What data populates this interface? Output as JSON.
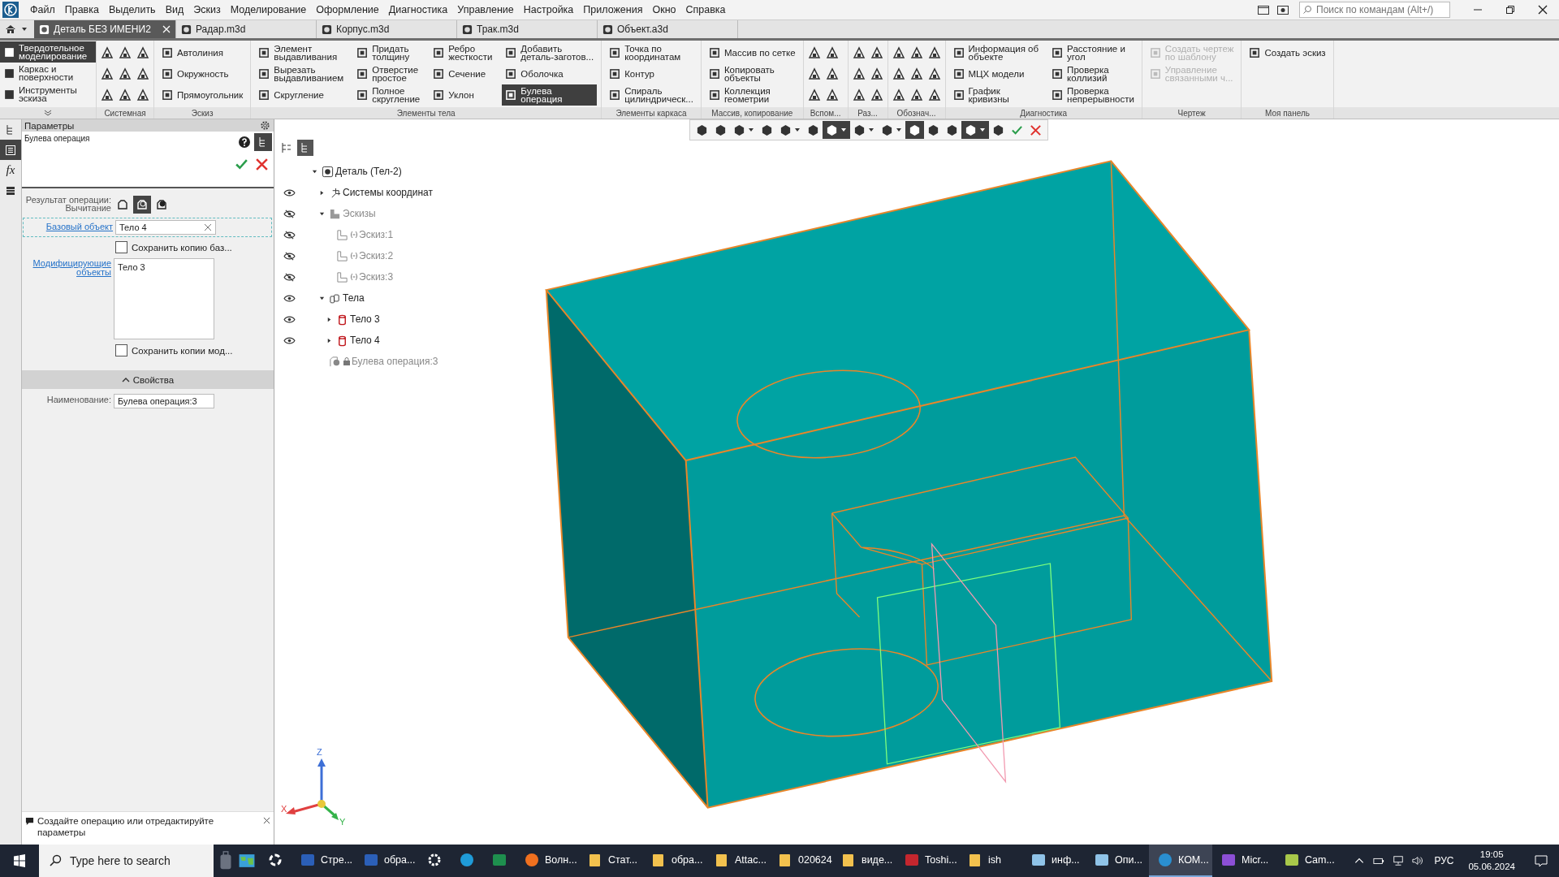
{
  "menu": [
    "Файл",
    "Правка",
    "Выделить",
    "Вид",
    "Эскиз",
    "Моделирование",
    "Оформление",
    "Диагностика",
    "Управление",
    "Настройка",
    "Приложения",
    "Окно",
    "Справка"
  ],
  "command_search": {
    "placeholder": "Поиск по командам (Alt+/)"
  },
  "tabs": [
    {
      "label": "Деталь БЕЗ ИМЕНИ2",
      "selected": true
    },
    {
      "label": "Радар.m3d",
      "selected": false
    },
    {
      "label": "Корпус.m3d",
      "selected": false
    },
    {
      "label": "Трак.m3d",
      "selected": false
    },
    {
      "label": "Объект.a3d",
      "selected": false
    }
  ],
  "ribbon": {
    "modes": [
      {
        "label": "Твердотельное\nмоделирование",
        "selected": true
      },
      {
        "label": "Каркас и\nповерхности",
        "selected": false
      },
      {
        "label": "Инструменты\nэскиза",
        "selected": false
      }
    ],
    "groups": [
      {
        "label": "Системная",
        "kind": "wide"
      },
      {
        "label": "Эскиз",
        "kind": "commands",
        "columns": [
          [
            {
              "label": "Автолиния"
            },
            {
              "label": "Окружность"
            },
            {
              "label": "Прямоугольник"
            }
          ]
        ]
      },
      {
        "label": "Элементы тела",
        "kind": "commands",
        "columns": [
          [
            {
              "label": "Элемент\nвыдавливания",
              "selected": false
            },
            {
              "label": "Вырезать\nвыдавливанием",
              "selected": false
            },
            {
              "label": "Скругление",
              "selected": false
            }
          ],
          [
            {
              "label": "Придать\nтолщину",
              "selected": false
            },
            {
              "label": "Отверстие\nпростое",
              "selected": false
            },
            {
              "label": "Полное\nскругление",
              "selected": false
            }
          ],
          [
            {
              "label": "Ребро\nжесткости",
              "selected": false
            },
            {
              "label": "Сечение",
              "selected": false
            },
            {
              "label": "Уклон",
              "selected": false
            }
          ],
          [
            {
              "label": "Добавить\nдеталь-заготов...",
              "selected": false
            },
            {
              "label": "Оболочка",
              "selected": false
            },
            {
              "label": "Булева\nоперация",
              "selected": true
            }
          ]
        ]
      },
      {
        "label": "Элементы каркаса",
        "kind": "commands",
        "columns": [
          [
            {
              "label": "Точка по\nкоординатам"
            },
            {
              "label": "Контур"
            },
            {
              "label": "Спираль\nцилиндрическ..."
            }
          ]
        ]
      },
      {
        "label": "Массив, копирование",
        "kind": "commands",
        "columns": [
          [
            {
              "label": "Массив по сетке"
            },
            {
              "label": "Копировать\nобъекты"
            },
            {
              "label": "Коллекция\nгеометрии"
            }
          ]
        ]
      },
      {
        "label": "Вспом...",
        "kind": "narrow"
      },
      {
        "label": "Раз...",
        "kind": "narrow"
      },
      {
        "label": "Обознач...",
        "kind": "wide"
      },
      {
        "label": "Диагностика",
        "kind": "commands",
        "columns": [
          [
            {
              "label": "Информация об\nобъекте"
            },
            {
              "label": "МЦХ модели"
            },
            {
              "label": "График\nкривизны"
            }
          ],
          [
            {
              "label": "Расстояние и\nугол"
            },
            {
              "label": "Проверка\nколлизий"
            },
            {
              "label": "Проверка\nнепрерывности"
            }
          ]
        ]
      },
      {
        "label": "Чертеж",
        "kind": "commands",
        "columns": [
          [
            {
              "label": "Создать чертеж\nпо шаблону",
              "disabled": true
            },
            {
              "label": "Управление\nсвязанными ч...",
              "disabled": true
            }
          ]
        ]
      },
      {
        "label": "Моя панель",
        "kind": "commands",
        "columns": [
          [
            {
              "label": "Создать эскиз"
            }
          ]
        ]
      }
    ]
  },
  "rail": [
    {
      "kind": "tree",
      "selected": false
    },
    {
      "kind": "params",
      "selected": true
    },
    {
      "kind": "formula",
      "label": "fx",
      "selected": false
    },
    {
      "kind": "layers",
      "selected": false
    }
  ],
  "parameters": {
    "title": "Параметры",
    "operation": "Булева операция",
    "result_label": "Результат операции:",
    "result_value": "Вычитание",
    "result_options": [
      {
        "selected": false
      },
      {
        "selected": true
      },
      {
        "selected": false
      }
    ],
    "base_label": "Базовый объект",
    "base_value": "Тело 4",
    "keep_base": {
      "label": "Сохранить копию баз...",
      "checked": false
    },
    "modifiers_label": "Модифицирующие объекты",
    "modifiers": [
      "Тело 3"
    ],
    "keep_modifiers": {
      "label": "Сохранить копии мод...",
      "checked": false
    },
    "properties_title": "Свойства",
    "name_label": "Наименование:",
    "name_value": "Булева операция:3"
  },
  "hint": "Создайте операцию или отредактируйте параметры",
  "view_toolbar": [
    {
      "kind": "tool",
      "selected": false
    },
    {
      "kind": "tool",
      "selected": false
    },
    {
      "kind": "menu",
      "selected": false
    },
    {
      "kind": "tool",
      "selected": false
    },
    {
      "kind": "menu",
      "selected": false
    },
    {
      "kind": "tool",
      "selected": false
    },
    {
      "kind": "menu",
      "selected": true
    },
    {
      "kind": "menu",
      "selected": false
    },
    {
      "kind": "menu",
      "selected": false
    },
    {
      "kind": "tool",
      "selected": true
    },
    {
      "kind": "tool",
      "selected": false
    },
    {
      "kind": "tool",
      "selected": false
    },
    {
      "kind": "menu",
      "selected": true
    },
    {
      "kind": "tool",
      "selected": false
    },
    {
      "kind": "ok",
      "selected": false
    },
    {
      "kind": "cancel",
      "selected": false
    }
  ],
  "tree": [
    {
      "label": "Деталь (Тел-2)",
      "kind": "part",
      "expanded": true,
      "dimmed": false,
      "children": [
        {
          "label": "Системы координат",
          "kind": "axes",
          "visible": true,
          "expanded": false,
          "dimmed": false
        },
        {
          "label": "Эскизы",
          "kind": "sketches",
          "visible": false,
          "expanded": true,
          "dimmed": true,
          "children": [
            {
              "label": "Эскиз:1",
              "kind": "sketch",
              "visible": false,
              "dimmed": true
            },
            {
              "label": "Эскиз:2",
              "kind": "sketch",
              "visible": false,
              "dimmed": true
            },
            {
              "label": "Эскиз:3",
              "kind": "sketch",
              "visible": false,
              "dimmed": true
            }
          ]
        },
        {
          "label": "Тела",
          "kind": "bodies",
          "visible": true,
          "expanded": true,
          "dimmed": false,
          "children": [
            {
              "label": "Тело 3",
              "kind": "body",
              "visible": true,
              "expanded": false,
              "dimmed": false
            },
            {
              "label": "Тело 4",
              "kind": "body",
              "visible": true,
              "expanded": false,
              "dimmed": false
            }
          ]
        },
        {
          "label": "Булева операция:3",
          "kind": "boolean",
          "dimmed": true
        }
      ]
    }
  ],
  "axes": {
    "x": "X",
    "y": "Y",
    "z": "Z"
  },
  "taskbar": {
    "search_placeholder": "Type here to search",
    "items": [
      {
        "kind": "taskview",
        "selected": false
      },
      {
        "kind": "word",
        "label": "Стре...",
        "selected": false
      },
      {
        "kind": "word",
        "label": "обра...",
        "selected": false
      },
      {
        "kind": "settings",
        "selected": false
      },
      {
        "kind": "edge",
        "selected": false
      },
      {
        "kind": "excel",
        "selected": false
      },
      {
        "kind": "firefox",
        "label": "Волн...",
        "selected": false
      },
      {
        "kind": "folder",
        "label": "Стат...",
        "selected": false
      },
      {
        "kind": "folder",
        "label": "обра...",
        "selected": false
      },
      {
        "kind": "folder",
        "label": "Attac...",
        "selected": false
      },
      {
        "kind": "folder",
        "label": "020624",
        "selected": false
      },
      {
        "kind": "folder",
        "label": "виде...",
        "selected": false
      },
      {
        "kind": "toshiba",
        "label": "Toshi...",
        "selected": false
      },
      {
        "kind": "folder",
        "label": "ish",
        "selected": false
      },
      {
        "kind": "notepad",
        "label": "инф...",
        "selected": false
      },
      {
        "kind": "notepad",
        "label": "Опи...",
        "selected": false
      },
      {
        "kind": "kompas",
        "label": "КОМ...",
        "selected": true
      },
      {
        "kind": "clipchamp",
        "label": "Micr...",
        "selected": false
      },
      {
        "kind": "camera",
        "label": "Cam...",
        "selected": false
      }
    ],
    "language": "РУС",
    "time": "19:05",
    "date": "05.06.2024"
  }
}
